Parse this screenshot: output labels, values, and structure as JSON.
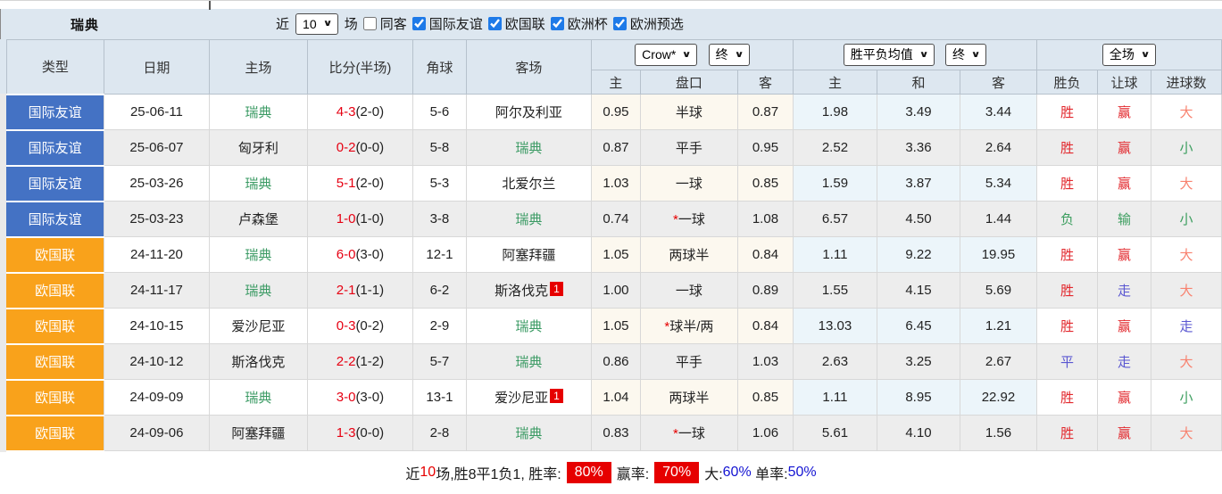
{
  "page": {
    "title": "瑞典"
  },
  "icons": {
    "chevron_down": "∨"
  },
  "colors": {
    "type_blue": "#4472c4",
    "type_orange": "#f9a21b",
    "team_green": "#3a9a63",
    "win_red": "#e2282d",
    "lose_green": "#3c9e5f",
    "draw_blue": "#5a57d1",
    "big_salmon": "#f8826f",
    "head_bg": "#dde7f0",
    "cream": "#fcf8ef",
    "lightblue": "#ecf5fa",
    "stripe": "#ededed",
    "badge_red": "#e60000",
    "rate_blue": "#1414d2",
    "score_red": "#e60012",
    "checkbox_blue": "#1e7ae8"
  },
  "controls": {
    "recent_label": "近",
    "recent_value": "10",
    "matches_label": "场",
    "same_away": {
      "label": "同客",
      "checked": false
    },
    "competitions": [
      {
        "label": "国际友谊",
        "checked": true
      },
      {
        "label": "欧国联",
        "checked": true
      },
      {
        "label": "欧洲杯",
        "checked": true
      },
      {
        "label": "欧洲预选",
        "checked": true
      }
    ]
  },
  "table": {
    "headers": [
      "类型",
      "日期",
      "主场",
      "比分(半场)",
      "角球",
      "客场"
    ],
    "oddsGroup": {
      "company": "Crow*",
      "time": "终",
      "sub": [
        "主",
        "盘口",
        "客"
      ]
    },
    "avgGroup": {
      "name": "胜平负均值",
      "time": "终",
      "sub": [
        "主",
        "和",
        "客"
      ]
    },
    "resultGroup": {
      "scope": "全场",
      "sub": [
        "胜负",
        "让球",
        "进球数"
      ]
    },
    "rows": [
      {
        "type": "国际友谊",
        "typeColor": "blue",
        "date": "25-06-11",
        "home": "瑞典",
        "homeFocus": true,
        "score": "4-3",
        "half": "(2-0)",
        "corners": "5-6",
        "away": "阿尔及利亚",
        "awayFocus": false,
        "awayBadge": "",
        "crowHome": "0.95",
        "handicapStar": "",
        "handicap": "半球",
        "crowAway": "0.87",
        "avgHome": "1.98",
        "avgDraw": "3.49",
        "avgAway": "3.44",
        "result": "胜",
        "resultColor": "red",
        "handicapResult": "赢",
        "handicapResultColor": "red",
        "goalsResult": "大",
        "goalsResultColor": "salmon"
      },
      {
        "type": "国际友谊",
        "typeColor": "blue",
        "date": "25-06-07",
        "home": "匈牙利",
        "homeFocus": false,
        "score": "0-2",
        "half": "(0-0)",
        "corners": "5-8",
        "away": "瑞典",
        "awayFocus": true,
        "awayBadge": "",
        "crowHome": "0.87",
        "handicapStar": "",
        "handicap": "平手",
        "crowAway": "0.95",
        "avgHome": "2.52",
        "avgDraw": "3.36",
        "avgAway": "2.64",
        "result": "胜",
        "resultColor": "red",
        "handicapResult": "赢",
        "handicapResultColor": "red",
        "goalsResult": "小",
        "goalsResultColor": "green"
      },
      {
        "type": "国际友谊",
        "typeColor": "blue",
        "date": "25-03-26",
        "home": "瑞典",
        "homeFocus": true,
        "score": "5-1",
        "half": "(2-0)",
        "corners": "5-3",
        "away": "北爱尔兰",
        "awayFocus": false,
        "awayBadge": "",
        "crowHome": "1.03",
        "handicapStar": "",
        "handicap": "一球",
        "crowAway": "0.85",
        "avgHome": "1.59",
        "avgDraw": "3.87",
        "avgAway": "5.34",
        "result": "胜",
        "resultColor": "red",
        "handicapResult": "赢",
        "handicapResultColor": "red",
        "goalsResult": "大",
        "goalsResultColor": "salmon"
      },
      {
        "type": "国际友谊",
        "typeColor": "blue",
        "date": "25-03-23",
        "home": "卢森堡",
        "homeFocus": false,
        "score": "1-0",
        "half": "(1-0)",
        "corners": "3-8",
        "away": "瑞典",
        "awayFocus": true,
        "awayBadge": "",
        "crowHome": "0.74",
        "handicapStar": "*",
        "handicap": "一球",
        "crowAway": "1.08",
        "avgHome": "6.57",
        "avgDraw": "4.50",
        "avgAway": "1.44",
        "result": "负",
        "resultColor": "green",
        "handicapResult": "输",
        "handicapResultColor": "green",
        "goalsResult": "小",
        "goalsResultColor": "green"
      },
      {
        "type": "欧国联",
        "typeColor": "orange",
        "date": "24-11-20",
        "home": "瑞典",
        "homeFocus": true,
        "score": "6-0",
        "half": "(3-0)",
        "corners": "12-1",
        "away": "阿塞拜疆",
        "awayFocus": false,
        "awayBadge": "",
        "crowHome": "1.05",
        "handicapStar": "",
        "handicap": "两球半",
        "crowAway": "0.84",
        "avgHome": "1.11",
        "avgDraw": "9.22",
        "avgAway": "19.95",
        "result": "胜",
        "resultColor": "red",
        "handicapResult": "赢",
        "handicapResultColor": "red",
        "goalsResult": "大",
        "goalsResultColor": "salmon"
      },
      {
        "type": "欧国联",
        "typeColor": "orange",
        "date": "24-11-17",
        "home": "瑞典",
        "homeFocus": true,
        "score": "2-1",
        "half": "(1-1)",
        "corners": "6-2",
        "away": "斯洛伐克",
        "awayFocus": false,
        "awayBadge": "1",
        "crowHome": "1.00",
        "handicapStar": "",
        "handicap": "一球",
        "crowAway": "0.89",
        "avgHome": "1.55",
        "avgDraw": "4.15",
        "avgAway": "5.69",
        "result": "胜",
        "resultColor": "red",
        "handicapResult": "走",
        "handicapResultColor": "blue",
        "goalsResult": "大",
        "goalsResultColor": "salmon"
      },
      {
        "type": "欧国联",
        "typeColor": "orange",
        "date": "24-10-15",
        "home": "爱沙尼亚",
        "homeFocus": false,
        "score": "0-3",
        "half": "(0-2)",
        "corners": "2-9",
        "away": "瑞典",
        "awayFocus": true,
        "awayBadge": "",
        "crowHome": "1.05",
        "handicapStar": "*",
        "handicap": "球半/两",
        "crowAway": "0.84",
        "avgHome": "13.03",
        "avgDraw": "6.45",
        "avgAway": "1.21",
        "result": "胜",
        "resultColor": "red",
        "handicapResult": "赢",
        "handicapResultColor": "red",
        "goalsResult": "走",
        "goalsResultColor": "blue"
      },
      {
        "type": "欧国联",
        "typeColor": "orange",
        "date": "24-10-12",
        "home": "斯洛伐克",
        "homeFocus": false,
        "score": "2-2",
        "half": "(1-2)",
        "corners": "5-7",
        "away": "瑞典",
        "awayFocus": true,
        "awayBadge": "",
        "crowHome": "0.86",
        "handicapStar": "",
        "handicap": "平手",
        "crowAway": "1.03",
        "avgHome": "2.63",
        "avgDraw": "3.25",
        "avgAway": "2.67",
        "result": "平",
        "resultColor": "blue",
        "handicapResult": "走",
        "handicapResultColor": "blue",
        "goalsResult": "大",
        "goalsResultColor": "salmon"
      },
      {
        "type": "欧国联",
        "typeColor": "orange",
        "date": "24-09-09",
        "home": "瑞典",
        "homeFocus": true,
        "score": "3-0",
        "half": "(3-0)",
        "corners": "13-1",
        "away": "爱沙尼亚",
        "awayFocus": false,
        "awayBadge": "1",
        "crowHome": "1.04",
        "handicapStar": "",
        "handicap": "两球半",
        "crowAway": "0.85",
        "avgHome": "1.11",
        "avgDraw": "8.95",
        "avgAway": "22.92",
        "result": "胜",
        "resultColor": "red",
        "handicapResult": "赢",
        "handicapResultColor": "red",
        "goalsResult": "小",
        "goalsResultColor": "green"
      },
      {
        "type": "欧国联",
        "typeColor": "orange",
        "date": "24-09-06",
        "home": "阿塞拜疆",
        "homeFocus": false,
        "score": "1-3",
        "half": "(0-0)",
        "corners": "2-8",
        "away": "瑞典",
        "awayFocus": true,
        "awayBadge": "",
        "crowHome": "0.83",
        "handicapStar": "*",
        "handicap": "一球",
        "crowAway": "1.06",
        "avgHome": "5.61",
        "avgDraw": "4.10",
        "avgAway": "1.56",
        "result": "胜",
        "resultColor": "red",
        "handicapResult": "赢",
        "handicapResultColor": "red",
        "goalsResult": "大",
        "goalsResultColor": "salmon"
      }
    ]
  },
  "summary": {
    "prefix": "近",
    "count": "10",
    "stats": "场,胜8平1负1, 胜率:",
    "win_rate": "80%",
    "handicap_label": "赢率:",
    "handicap_rate": "70%",
    "big_label": "大:",
    "big_rate": "60%",
    "single_label": "单率:",
    "single_rate": "50%"
  }
}
